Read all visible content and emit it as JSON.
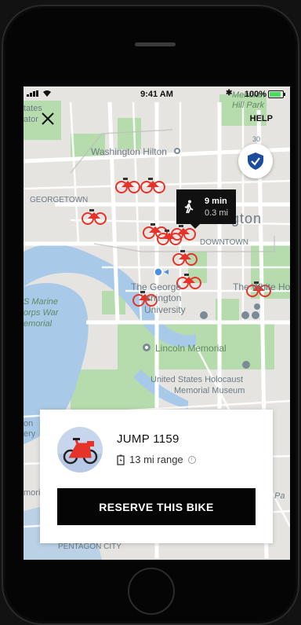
{
  "status_bar": {
    "time": "9:41 AM",
    "battery": "100%"
  },
  "header": {
    "help_label": "HELP"
  },
  "map": {
    "labels": {
      "top_left": "tates",
      "top_left_2": "ator",
      "washington_hilton": "Washington Hilton",
      "georgetown": "GEORGETOWN",
      "downtown": "DOWNTOWN",
      "washington": "ngton",
      "george_washington_1": "The George",
      "george_washington_2": "shington",
      "george_washington_3": "University",
      "white_house": "The White Ho",
      "merid_hill_1": "Meridian",
      "merid_hill_2": "Hill Park",
      "marine_1": "S Marine",
      "marine_2": "orps War",
      "marine_3": "emorial",
      "lincoln_memorial": "Lincoln Memorial",
      "holocaust_1": "United States Holocaust",
      "holocaust_2": "Memorial Museum",
      "pentagon_city": "PENTAGON CITY",
      "left_edge_1": "on",
      "left_edge_2": "ery",
      "left_edge_3": "mori",
      "right_edge_1": "Pa",
      "right_edge_2": "30",
      "right_edge_3": "St NW"
    },
    "walk_time": "9 min",
    "walk_distance": "0.3 mi"
  },
  "bike_card": {
    "name": "JUMP 1159",
    "range": "13 mi range",
    "info_glyph": "i",
    "reserve_label": "RESERVE THIS BIKE"
  },
  "colors": {
    "map_bg": "#e6e4e0",
    "park": "#b6dcae",
    "water": "#a8c9e8",
    "road": "#ffffff",
    "bike_red": "#e5332a",
    "button": "#050505"
  },
  "icons": [
    "close-icon",
    "shield-check-icon",
    "walking-person-icon",
    "battery-icon",
    "info-icon",
    "bike-icon",
    "location-dot-icon"
  ]
}
